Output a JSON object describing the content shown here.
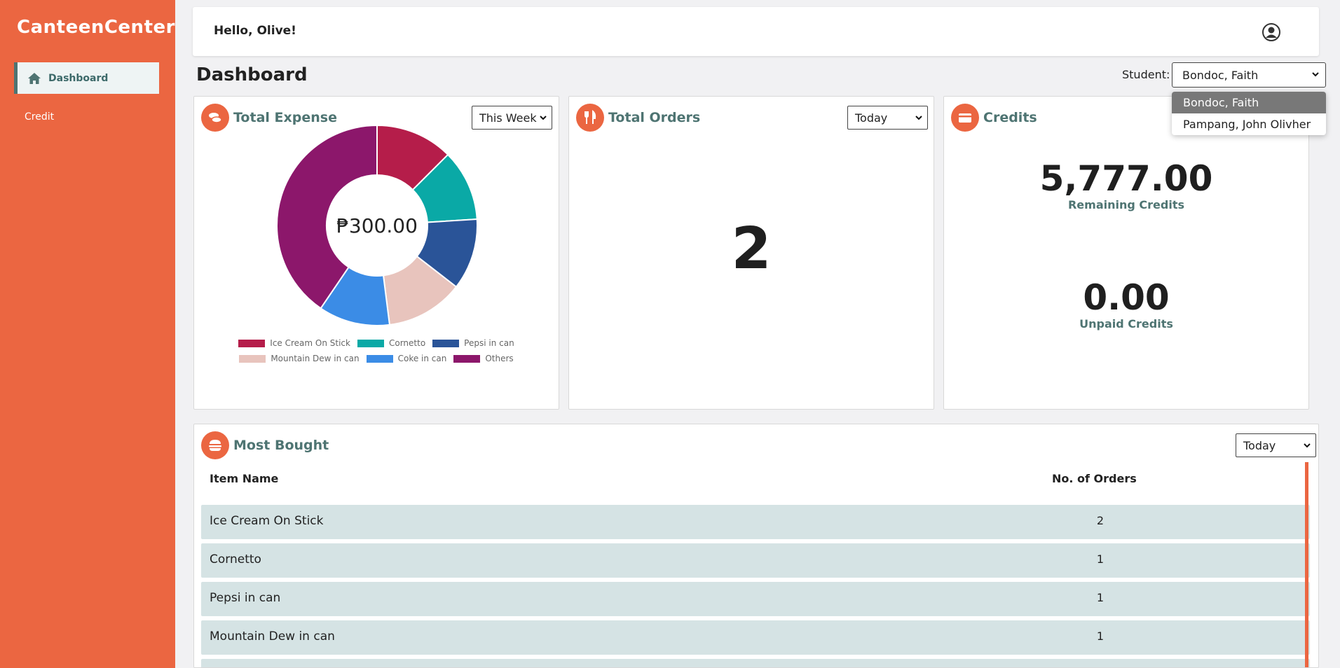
{
  "app": {
    "brand": "CanteenCenter"
  },
  "sidebar": {
    "items": [
      {
        "label": "Dashboard",
        "active": true,
        "icon": "home-icon"
      },
      {
        "label": "Credit",
        "active": false
      }
    ]
  },
  "header": {
    "greeting": "Hello, Olive!"
  },
  "page": {
    "title": "Dashboard"
  },
  "student": {
    "label": "Student:",
    "selected": "Bondoc, Faith",
    "options": [
      "Bondoc, Faith",
      "Pampang, John Olivher"
    ]
  },
  "expense_card": {
    "title": "Total Expense",
    "period": "This Week",
    "total": "₱300.00",
    "icon": "coins-icon"
  },
  "orders_card": {
    "title": "Total Orders",
    "period": "Today",
    "count": "2",
    "icon": "utensils-icon"
  },
  "credits_card": {
    "title": "Credits",
    "remaining_value": "5,777.00",
    "remaining_label": "Remaining Credits",
    "unpaid_value": "0.00",
    "unpaid_label": "Unpaid Credits",
    "icon": "card-icon"
  },
  "most_bought": {
    "title": "Most Bought",
    "period": "Today",
    "icon": "burger-icon",
    "columns": [
      "Item Name",
      "No. of Orders"
    ],
    "rows": [
      {
        "name": "Ice Cream On Stick",
        "count": "2"
      },
      {
        "name": "Cornetto",
        "count": "1"
      },
      {
        "name": "Pepsi in can",
        "count": "1"
      },
      {
        "name": "Mountain Dew in can",
        "count": "1"
      }
    ]
  },
  "colors": {
    "accent": "#eb6641",
    "teal_text": "#4e7472",
    "row_bg": "#d5e3e4"
  },
  "chart_data": {
    "type": "pie",
    "title": "",
    "categories": [
      "Ice Cream On Stick",
      "Cornetto",
      "Pepsi in can",
      "Mountain Dew in can",
      "Coke in can",
      "Others"
    ],
    "values": [
      12.5,
      11.5,
      11.5,
      12.5,
      11.5,
      40.5
    ],
    "colors": [
      "#b51d4a",
      "#0aa9a6",
      "#2a5498",
      "#e8c4bd",
      "#3b8ce6",
      "#8c176b"
    ],
    "center_label": "₱300.00",
    "legend_placement": "bottom"
  }
}
